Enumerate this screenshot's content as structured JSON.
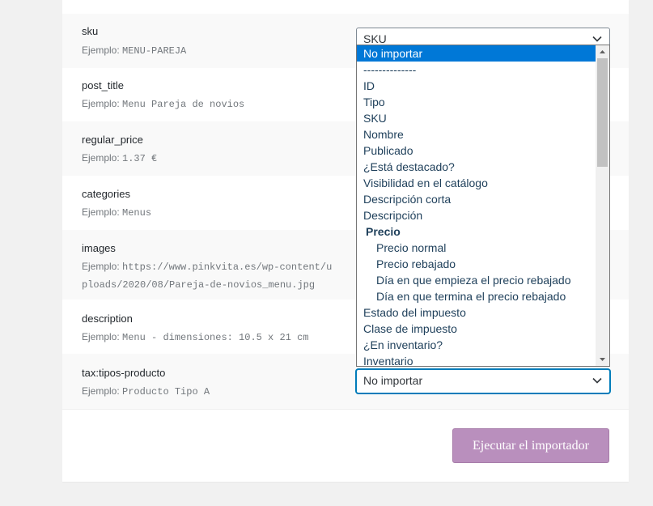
{
  "rows": [
    {
      "name": "sku",
      "example_label": "Ejemplo:",
      "example_value": "MENU-PAREJA"
    },
    {
      "name": "post_title",
      "example_label": "Ejemplo:",
      "example_value": "Menu Pareja de novios"
    },
    {
      "name": "regular_price",
      "example_label": "Ejemplo:",
      "example_value": "1.37 €"
    },
    {
      "name": "categories",
      "example_label": "Ejemplo:",
      "example_value": "Menus"
    },
    {
      "name": "images",
      "example_label": "Ejemplo:",
      "example_value_line1": "https://www.pinkvita.es/wp-content/u",
      "example_value_line2": "ploads/2020/08/Pareja-de-novios_menu.jpg"
    },
    {
      "name": "description",
      "example_label": "Ejemplo:",
      "example_value": "Menu - dimensiones: 10.5 x 21 cm"
    },
    {
      "name": "tax:tipos-producto",
      "example_label": "Ejemplo:",
      "example_value": "Producto Tipo A"
    }
  ],
  "sku_select_value": "SKU",
  "tax_select_value": "No importar",
  "dropdown_options": {
    "selected": "No importar",
    "separator": "--------------",
    "items": [
      "ID",
      "Tipo",
      "SKU",
      "Nombre",
      "Publicado",
      "¿Está destacado?",
      "Visibilidad en el catálogo",
      "Descripción corta",
      "Descripción"
    ],
    "group_label": "Precio",
    "group_items": [
      "Precio normal",
      "Precio rebajado",
      "Día en que empieza el precio rebajado",
      "Día en que termina el precio rebajado"
    ],
    "after_items": [
      "Estado del impuesto",
      "Clase de impuesto",
      "¿En inventario?",
      "Inventario"
    ]
  },
  "run_button_label": "Ejecutar el importador",
  "colors": {
    "accent": "#b98fbd",
    "selection": "#0078d7",
    "focus": "#007cba"
  }
}
